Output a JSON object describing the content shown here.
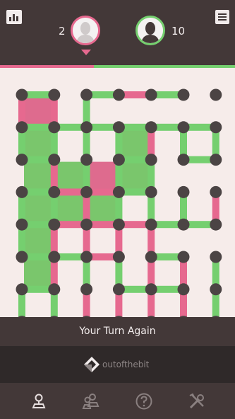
{
  "header": {
    "stats_icon": "leaderboard-icon",
    "menu_icon": "hamburger-menu-icon"
  },
  "players": [
    {
      "score": "2",
      "color": "#e6698f",
      "icon": "user-avatar-icon"
    },
    {
      "score": "10",
      "color": "#75cf6f",
      "icon": "user-avatar-icon"
    }
  ],
  "score_bar": {
    "pink_share": 0.4,
    "green_share": 0.6
  },
  "board": {
    "cols": 6,
    "rows": 7,
    "colors": {
      "pink": "#e6698f",
      "green": "#75cf6f",
      "dot": "#4b4444",
      "pink_box": "#d9557e",
      "green_box": "#64c056",
      "background": "#f6ecea"
    },
    "horizontal_lines": [
      [
        0,
        0,
        "g"
      ],
      [
        0,
        2,
        "g"
      ],
      [
        0,
        3,
        "p"
      ],
      [
        0,
        4,
        "g"
      ],
      [
        1,
        0,
        "g"
      ],
      [
        1,
        1,
        "g"
      ],
      [
        1,
        2,
        "g"
      ],
      [
        1,
        3,
        "g"
      ],
      [
        1,
        4,
        "g"
      ],
      [
        1,
        5,
        "g"
      ],
      [
        2,
        0,
        "g"
      ],
      [
        2,
        3,
        "g"
      ],
      [
        2,
        5,
        "g"
      ],
      [
        3,
        0,
        "g"
      ],
      [
        3,
        1,
        "p"
      ],
      [
        3,
        2,
        "p"
      ],
      [
        3,
        3,
        "g"
      ],
      [
        4,
        0,
        "g"
      ],
      [
        4,
        1,
        "p"
      ],
      [
        4,
        2,
        "p"
      ],
      [
        4,
        3,
        "p"
      ],
      [
        4,
        4,
        "g"
      ],
      [
        4,
        5,
        "g"
      ],
      [
        5,
        0,
        "g"
      ],
      [
        5,
        1,
        "g"
      ],
      [
        5,
        2,
        "p"
      ],
      [
        5,
        4,
        "g"
      ],
      [
        6,
        0,
        "g"
      ],
      [
        6,
        3,
        "g"
      ],
      [
        6,
        4,
        "g"
      ],
      [
        7,
        0,
        "g"
      ],
      [
        7,
        2,
        "p"
      ],
      [
        7,
        3,
        "p"
      ],
      [
        7,
        4,
        "p"
      ],
      [
        7,
        5,
        "p"
      ],
      [
        7,
        6,
        "p"
      ]
    ],
    "vertical_lines": [
      [
        0,
        0,
        "p"
      ],
      [
        0,
        1,
        "p"
      ],
      [
        0,
        2,
        "g"
      ],
      [
        1,
        0,
        "g"
      ],
      [
        1,
        1,
        "g"
      ],
      [
        1,
        2,
        "g"
      ],
      [
        1,
        3,
        "g"
      ],
      [
        1,
        4,
        "p"
      ],
      [
        1,
        5,
        "g"
      ],
      [
        1,
        6,
        "g"
      ],
      [
        2,
        1,
        "p"
      ],
      [
        2,
        2,
        "g"
      ],
      [
        2,
        3,
        "g"
      ],
      [
        2,
        4,
        "g"
      ],
      [
        3,
        0,
        "g"
      ],
      [
        3,
        1,
        "g"
      ],
      [
        3,
        2,
        "p"
      ],
      [
        3,
        3,
        "g"
      ],
      [
        3,
        4,
        "g"
      ],
      [
        3,
        5,
        "g"
      ],
      [
        3,
        6,
        "p"
      ],
      [
        4,
        0,
        "g"
      ],
      [
        4,
        1,
        "p"
      ],
      [
        4,
        2,
        "p"
      ],
      [
        4,
        3,
        "p"
      ],
      [
        4,
        4,
        "p"
      ],
      [
        5,
        1,
        "p"
      ],
      [
        5,
        2,
        "g"
      ],
      [
        5,
        3,
        "g"
      ],
      [
        5,
        4,
        "p"
      ],
      [
        5,
        5,
        "p"
      ],
      [
        5,
        6,
        "g"
      ],
      [
        6,
        0,
        "g"
      ],
      [
        6,
        1,
        "g"
      ],
      [
        6,
        2,
        "p"
      ],
      [
        6,
        3,
        "p"
      ],
      [
        6,
        4,
        "p"
      ],
      [
        6,
        5,
        "p"
      ],
      [
        6,
        6,
        "g"
      ],
      [
        7,
        0,
        "p"
      ],
      [
        7,
        1,
        "g"
      ],
      [
        7,
        2,
        "p"
      ],
      [
        7,
        3,
        "p"
      ],
      [
        7,
        4,
        "p"
      ],
      [
        7,
        5,
        "p"
      ],
      [
        7,
        6,
        "g"
      ]
    ],
    "boxes": [
      [
        0,
        0,
        "p"
      ],
      [
        1,
        0,
        "g"
      ],
      [
        1,
        3,
        "g"
      ],
      [
        2,
        0,
        "g"
      ],
      [
        2,
        1,
        "g"
      ],
      [
        2,
        2,
        "p"
      ],
      [
        2,
        3,
        "g"
      ],
      [
        3,
        0,
        "g"
      ],
      [
        3,
        1,
        "g"
      ],
      [
        3,
        2,
        "g"
      ],
      [
        4,
        0,
        "g"
      ],
      [
        5,
        0,
        "g"
      ]
    ]
  },
  "status": "Your Turn Again",
  "sponsor": {
    "logo_icon": "outofthebit-logo-icon",
    "text": "outofthebit"
  },
  "nav": [
    {
      "icon": "single-player-icon"
    },
    {
      "icon": "multiplayer-icon"
    },
    {
      "icon": "help-icon"
    },
    {
      "icon": "tools-icon"
    }
  ]
}
